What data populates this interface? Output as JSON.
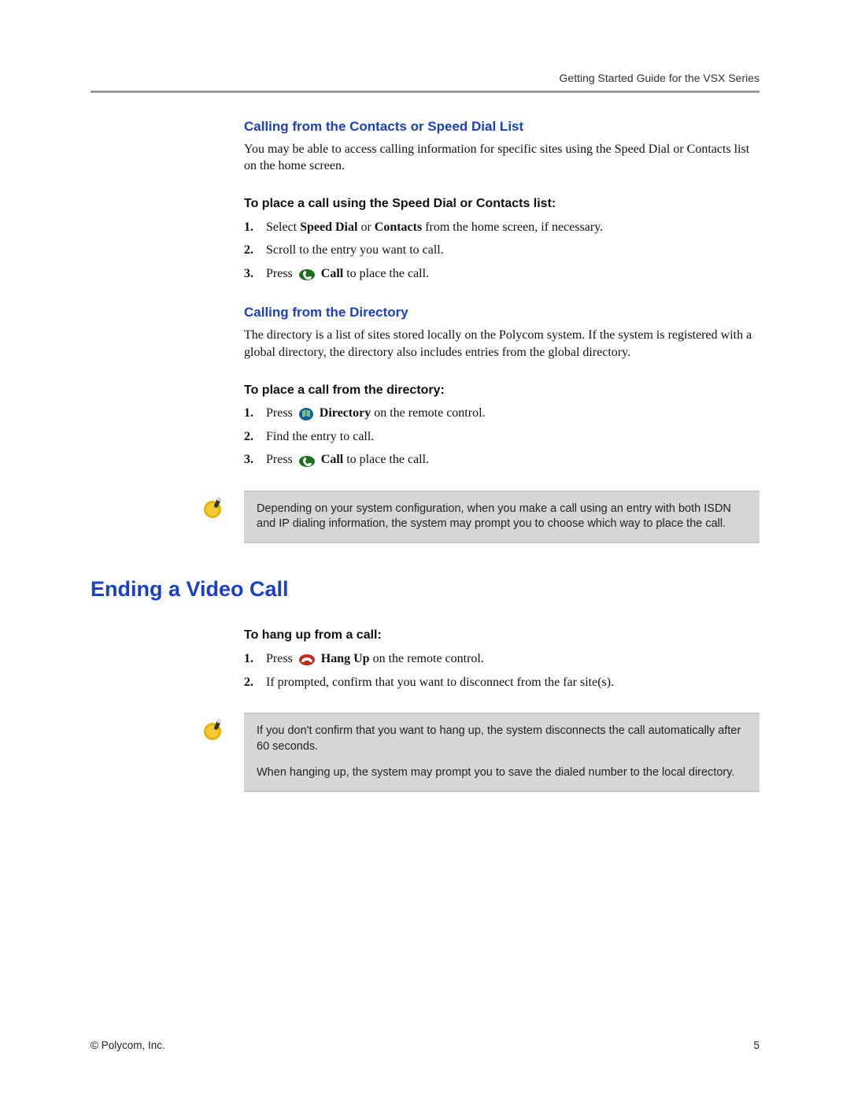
{
  "header": {
    "running": "Getting Started Guide for the VSX Series"
  },
  "sec1": {
    "title": "Calling from the Contacts or Speed Dial List",
    "intro": "You may be able to access calling information for specific sites using the Speed Dial or Contacts list on the home screen.",
    "howto_title": "To place a call using the Speed Dial or Contacts list:",
    "step1_pre": "Select ",
    "step1_b1": "Speed Dial",
    "step1_mid": " or ",
    "step1_b2": "Contacts",
    "step1_post": " from the home screen, if necessary.",
    "step2": "Scroll to the entry you want to call.",
    "step3_pre": "Press ",
    "step3_b": " Call",
    "step3_post": " to place the call."
  },
  "sec2": {
    "title": "Calling from the Directory",
    "intro": "The directory is a list of sites stored locally on the Polycom system. If the system is registered with a global directory, the directory also includes entries from the global directory.",
    "howto_title": "To place a call from the directory:",
    "step1_pre": "Press ",
    "step1_b": " Directory",
    "step1_post": " on the remote control.",
    "step2": "Find the entry to call.",
    "step3_pre": "Press ",
    "step3_b": " Call",
    "step3_post": " to place the call."
  },
  "note1": {
    "text": "Depending on your system configuration, when you make a call using an entry with both ISDN and IP dialing information, the system may prompt you to choose which way to place the call."
  },
  "major": {
    "title": "Ending a Video Call"
  },
  "sec3": {
    "howto_title": "To hang up from a call:",
    "step1_pre": "Press ",
    "step1_b": " Hang Up",
    "step1_post": " on the remote control.",
    "step2": "If prompted, confirm that you want to disconnect from the far site(s)."
  },
  "note2": {
    "p1": "If you don't confirm that you want to hang up, the system disconnects the call automatically after 60 seconds.",
    "p2": "When hanging up, the system may prompt you to save the dialed number to the local directory."
  },
  "footer": {
    "left": "© Polycom, Inc.",
    "right": "5"
  }
}
